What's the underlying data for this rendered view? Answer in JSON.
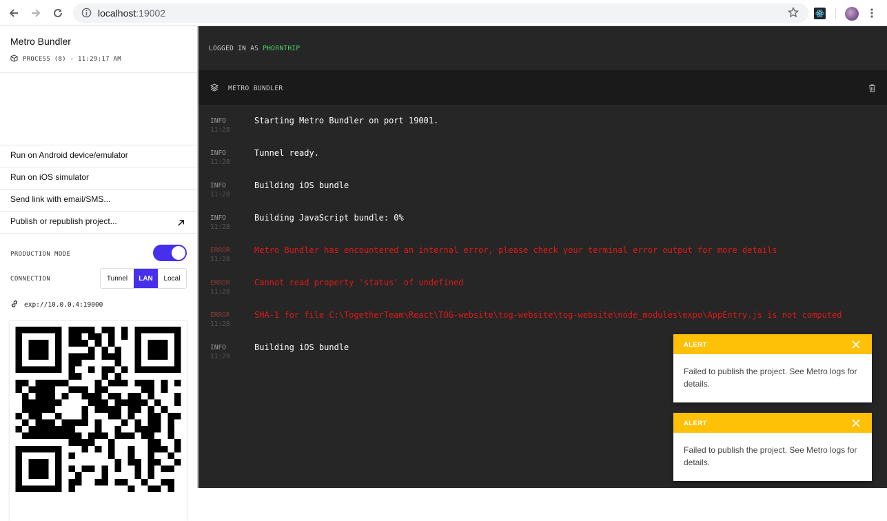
{
  "browser": {
    "url_host": "localhost",
    "url_port": ":19002"
  },
  "sidebar": {
    "title": "Metro Bundler",
    "process": "PROCESS (8) - 11:29:17 AM",
    "menu": [
      {
        "label": "Run on Android device/emulator"
      },
      {
        "label": "Run on iOS simulator"
      },
      {
        "label": "Send link with email/SMS..."
      },
      {
        "label": "Publish or republish project..."
      }
    ],
    "production_mode_label": "PRODUCTION MODE",
    "production_mode_on": true,
    "connection_label": "CONNECTION",
    "connection_options": [
      "Tunnel",
      "LAN",
      "Local"
    ],
    "connection_selected": "LAN",
    "exp_url": "exp://10.0.0.4:19000"
  },
  "main": {
    "logged_in_prefix": "LOGGED IN AS",
    "logged_in_user": "PHORNTHIP",
    "panel_title": "METRO BUNDLER",
    "logs": [
      {
        "level": "INFO",
        "time": "11:28",
        "message": "Starting Metro Bundler on port 19001.",
        "error": false
      },
      {
        "level": "INFO",
        "time": "11:28",
        "message": "Tunnel ready.",
        "error": false
      },
      {
        "level": "INFO",
        "time": "11:28",
        "message": "Building iOS bundle",
        "error": false
      },
      {
        "level": "INFO",
        "time": "11:28",
        "message": "Building JavaScript bundle: 0%",
        "error": false
      },
      {
        "level": "ERROR",
        "time": "11:28",
        "message": "Metro Bundler has encountered an internal error, please check your terminal error output for more details",
        "error": true
      },
      {
        "level": "ERROR",
        "time": "11:28",
        "message": "Cannot read property 'status' of undefined",
        "error": true
      },
      {
        "level": "ERROR",
        "time": "11:28",
        "message": "SHA-1 for file C:\\TogetherTeam\\React\\TOG-website\\tog-website\\tog-website\\node_modules\\expo\\AppEntry.js is not computed",
        "error": true
      },
      {
        "level": "INFO",
        "time": "11:29",
        "message": "Building iOS bundle",
        "error": false
      }
    ]
  },
  "alerts": [
    {
      "title": "ALERT",
      "message": "Failed to publish the project. See Metro logs for details."
    },
    {
      "title": "ALERT",
      "message": "Failed to publish the project. See Metro logs for details."
    }
  ],
  "colors": {
    "accent": "#4630eb",
    "alert": "#ffc107",
    "error": "#e01818",
    "user": "#4ad56a"
  }
}
